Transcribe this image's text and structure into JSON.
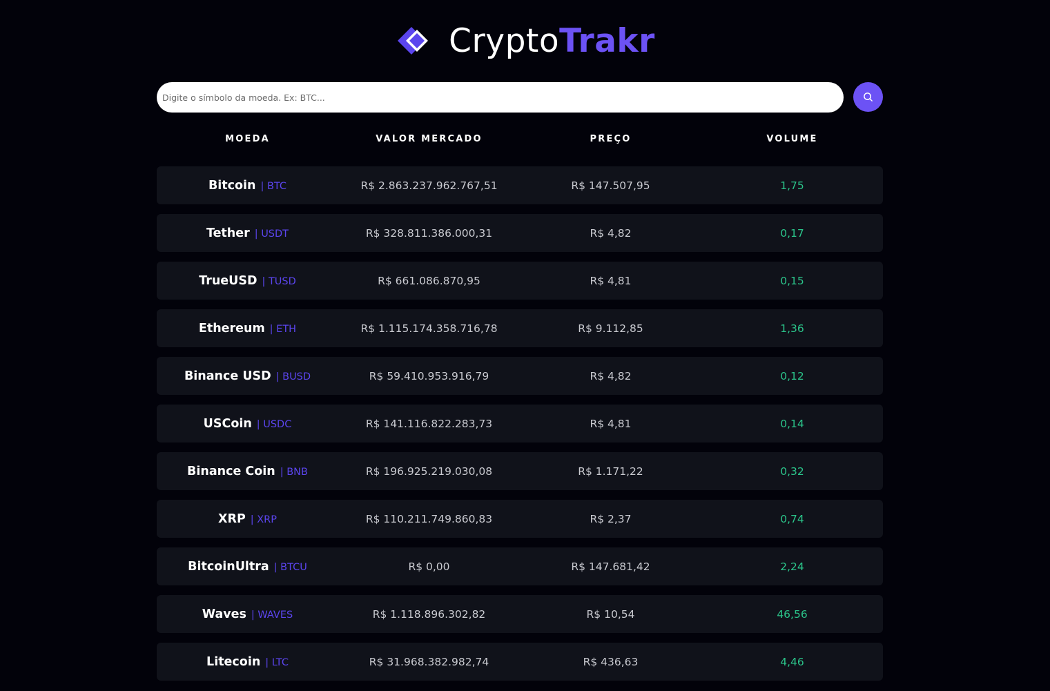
{
  "brand": {
    "title_part1": "Crypto",
    "title_part2": "Trakr",
    "icon": "diamond-logo-icon",
    "accent_color": "#6c52f5"
  },
  "search": {
    "placeholder": "Digite o símbolo da moeda. Ex: BTC...",
    "value": "",
    "icon": "search-icon"
  },
  "table": {
    "headers": [
      "MOEDA",
      "VALOR MERCADO",
      "PREÇO",
      "VOLUME"
    ],
    "rows": [
      {
        "name": "Bitcoin",
        "symbol": "| BTC",
        "market_cap": "R$ 2.863.237.962.767,51",
        "price": "R$ 147.507,95",
        "volume": "1,75"
      },
      {
        "name": "Tether",
        "symbol": "| USDT",
        "market_cap": "R$ 328.811.386.000,31",
        "price": "R$ 4,82",
        "volume": "0,17"
      },
      {
        "name": "TrueUSD",
        "symbol": "| TUSD",
        "market_cap": "R$ 661.086.870,95",
        "price": "R$ 4,81",
        "volume": "0,15"
      },
      {
        "name": "Ethereum",
        "symbol": "| ETH",
        "market_cap": "R$ 1.115.174.358.716,78",
        "price": "R$ 9.112,85",
        "volume": "1,36"
      },
      {
        "name": "Binance USD",
        "symbol": "| BUSD",
        "market_cap": "R$ 59.410.953.916,79",
        "price": "R$ 4,82",
        "volume": "0,12"
      },
      {
        "name": "USCoin",
        "symbol": "| USDC",
        "market_cap": "R$ 141.116.822.283,73",
        "price": "R$ 4,81",
        "volume": "0,14"
      },
      {
        "name": "Binance Coin",
        "symbol": "| BNB",
        "market_cap": "R$ 196.925.219.030,08",
        "price": "R$ 1.171,22",
        "volume": "0,32"
      },
      {
        "name": "XRP",
        "symbol": "| XRP",
        "market_cap": "R$ 110.211.749.860,83",
        "price": "R$ 2,37",
        "volume": "0,74"
      },
      {
        "name": "BitcoinUltra",
        "symbol": "| BTCU",
        "market_cap": "R$ 0,00",
        "price": "R$ 147.681,42",
        "volume": "2,24"
      },
      {
        "name": "Waves",
        "symbol": "| WAVES",
        "market_cap": "R$ 1.118.896.302,82",
        "price": "R$ 10,54",
        "volume": "46,56"
      },
      {
        "name": "Litecoin",
        "symbol": "| LTC",
        "market_cap": "R$ 31.968.382.982,74",
        "price": "R$ 436,63",
        "volume": "4,46"
      }
    ]
  }
}
